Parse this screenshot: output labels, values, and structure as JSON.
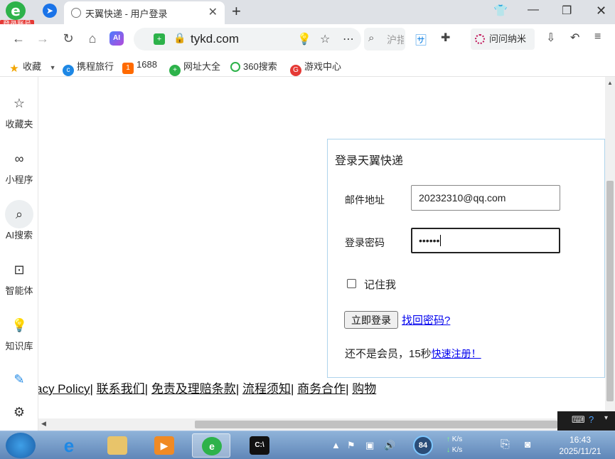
{
  "browser": {
    "app_badge": "登录账号",
    "tab_title": "天翼快递 - 用户登录",
    "address_url": "tykd.com",
    "search_placeholder": "沪指",
    "extension_label": "问问纳米",
    "ai_label": "AI"
  },
  "bookmarks": [
    {
      "label": "收藏",
      "icon": "star-icon",
      "color": "#f2a500"
    },
    {
      "label": "携程旅行",
      "icon": "ctrip-icon",
      "color": "#1e88e5"
    },
    {
      "label": "1688",
      "icon": "1688-icon",
      "color": "#ff6a00"
    },
    {
      "label": "网址大全",
      "icon": "360-nav-icon",
      "color": "#2db24a"
    },
    {
      "label": "360搜索",
      "icon": "360-search-icon",
      "color": "#2db24a"
    },
    {
      "label": "游戏中心",
      "icon": "game-icon",
      "color": "#e53935"
    }
  ],
  "sidebar": [
    {
      "label": "收藏夹",
      "icon": "star-outline-icon"
    },
    {
      "label": "小程序",
      "icon": "mini-program-icon"
    },
    {
      "label": "AI搜索",
      "icon": "ai-search-icon"
    },
    {
      "label": "智能体",
      "icon": "agent-icon"
    },
    {
      "label": "知识库",
      "icon": "knowledge-icon"
    }
  ],
  "login": {
    "title": "登录天翼快递",
    "email_label": "邮件地址",
    "email_value": "20232310@qq.com",
    "password_label": "登录密码",
    "password_mask": "••••••",
    "remember_label": "记住我",
    "login_button": "立即登录",
    "forgot_link": "找回密码?",
    "member_text": "还不是会员，15秒",
    "register_link": "快速注册！"
  },
  "footer": {
    "privacy": "acy Policy",
    "contact": "联系我们",
    "terms": "免责及理赔条款",
    "process": "流程须知",
    "business": "商务合作",
    "shop": "购物"
  },
  "taskbar": {
    "gauge_value": "84",
    "net_up": "K/s",
    "net_down": "K/s",
    "time": "16:43",
    "date": "2025/11/21",
    "accent": "#5f86b8"
  }
}
